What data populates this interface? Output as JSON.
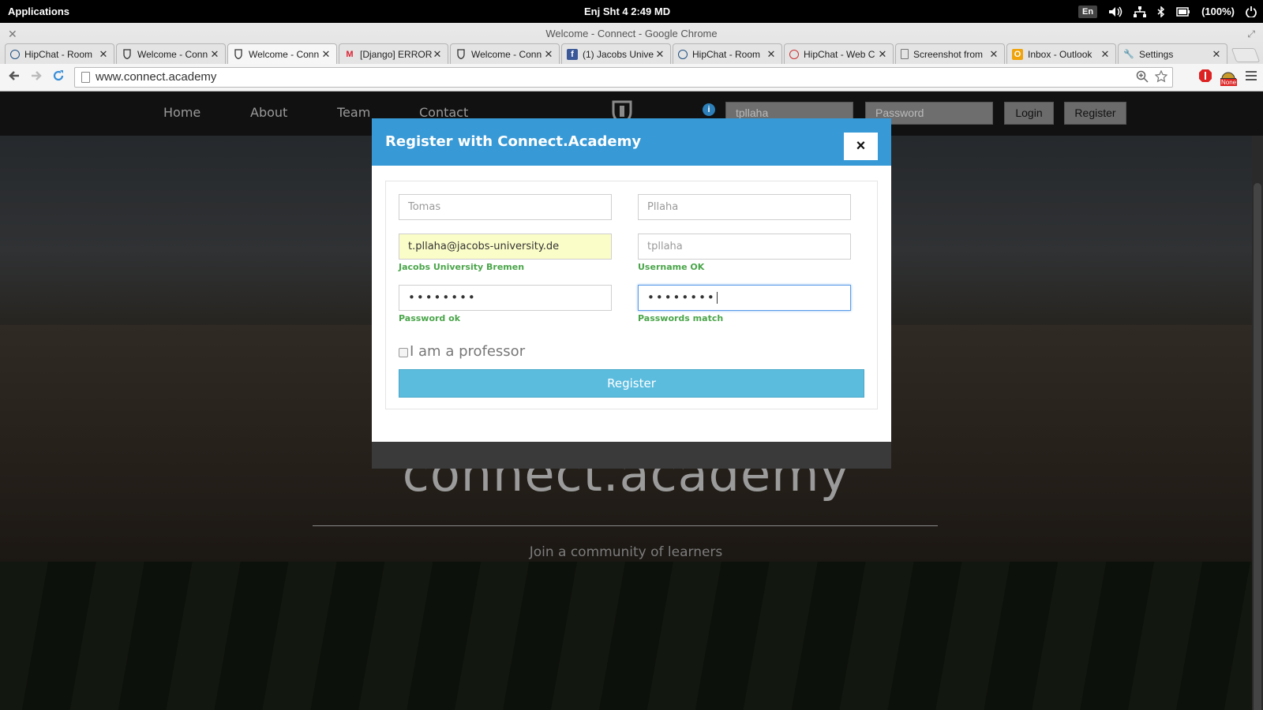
{
  "system_bar": {
    "applications": "Applications",
    "clock": "Enj  Sht 4    2:49 MD",
    "language": "En",
    "battery": "(100%)"
  },
  "browser": {
    "window_title": "Welcome - Connect - Google Chrome",
    "url": "www.connect.academy",
    "extension_badge": "None",
    "tabs": [
      {
        "label": "HipChat - Room",
        "icon": "hipchat-icon",
        "active": false
      },
      {
        "label": "Welcome - Conn",
        "icon": "connect-shield-icon",
        "active": false
      },
      {
        "label": "Welcome - Conn",
        "icon": "connect-shield-icon",
        "active": true
      },
      {
        "label": "[Django] ERROR",
        "icon": "gmail-icon",
        "active": false
      },
      {
        "label": "Welcome - Conn",
        "icon": "connect-shield-icon",
        "active": false
      },
      {
        "label": "(1) Jacobs Unive",
        "icon": "facebook-icon",
        "active": false
      },
      {
        "label": "HipChat - Room",
        "icon": "hipchat-icon",
        "active": false
      },
      {
        "label": "HipChat - Web C",
        "icon": "hipchat-icon",
        "active": false
      },
      {
        "label": "Screenshot from",
        "icon": "document-icon",
        "active": false
      },
      {
        "label": "Inbox - Outlook",
        "icon": "outlook-icon",
        "active": false
      },
      {
        "label": "Settings",
        "icon": "wrench-icon",
        "active": false
      }
    ]
  },
  "site": {
    "nav": {
      "home": "Home",
      "about": "About",
      "team": "Team",
      "contact": "Contact",
      "username_value": "tpllaha",
      "password_placeholder": "Password",
      "login": "Login",
      "register": "Register"
    },
    "hero_title": "connect.academy",
    "hero_subtitle": "Join a community of learners"
  },
  "modal": {
    "title": "Register with Connect.Academy",
    "close": "×",
    "first_name": "Tomas",
    "last_name": "Pllaha",
    "email": "t.pllaha@jacobs-university.de",
    "email_hint": "Jacobs University Bremen",
    "username": "tpllaha",
    "username_hint": "Username OK",
    "password_mask": "••••••••",
    "password_hint": "Password ok",
    "confirm_mask": "••••••••",
    "confirm_hint": "Passwords match",
    "professor_label": "I am a professor",
    "professor_checked": false,
    "submit": "Register",
    "hint_color": "#4aa54a",
    "header_color": "#3799d6",
    "button_color": "#5cbcde"
  }
}
